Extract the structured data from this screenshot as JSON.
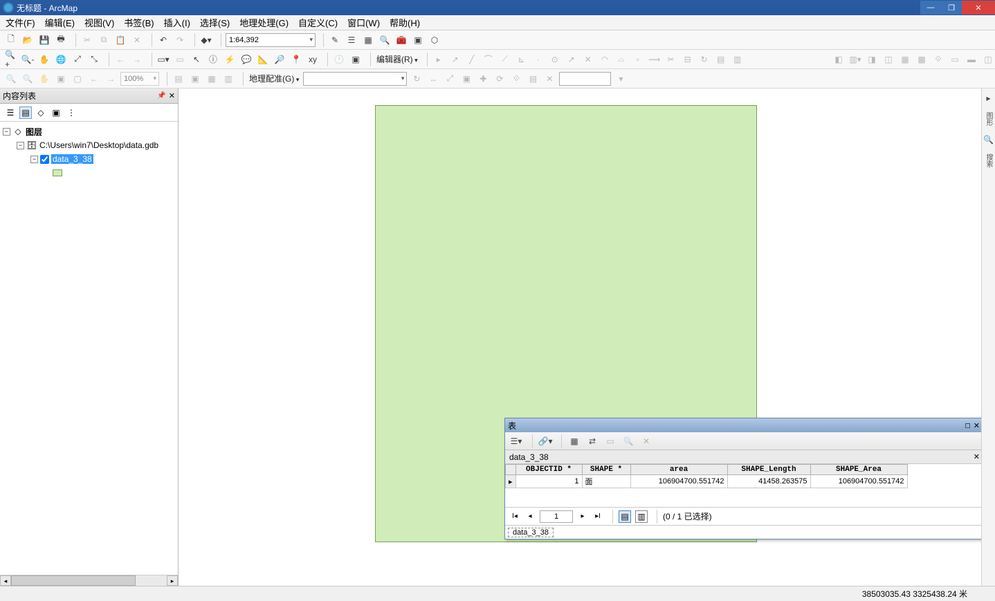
{
  "window": {
    "title": "无标题 - ArcMap"
  },
  "menu": [
    "文件(F)",
    "编辑(E)",
    "视图(V)",
    "书签(B)",
    "插入(I)",
    "选择(S)",
    "地理处理(G)",
    "自定义(C)",
    "窗口(W)",
    "帮助(H)"
  ],
  "toolbar1": {
    "scale": "1:64,392"
  },
  "toolbar3": {
    "zoom": "100%",
    "georef": "地理配准(G)",
    "editor": "编辑器(R)"
  },
  "toc": {
    "title": "内容列表",
    "root": "图层",
    "gdb": "C:\\Users\\win7\\Desktop\\data.gdb",
    "layer": "data_3_38"
  },
  "attr": {
    "title": "表",
    "subtitle": "data_3_38",
    "columns": [
      "OBJECTID *",
      "SHAPE *",
      "area",
      "SHAPE_Length",
      "SHAPE_Area"
    ],
    "row": {
      "objectid": "1",
      "shape": "面",
      "area": "106904700.551742",
      "len": "41458.263575",
      "sarea": "106904700.551742"
    },
    "nav_page": "1",
    "sel_text": "(0 / 1 已选择)",
    "tab": "data_3_38"
  },
  "status": {
    "coords": "38503035.43  3325438.24 米"
  }
}
